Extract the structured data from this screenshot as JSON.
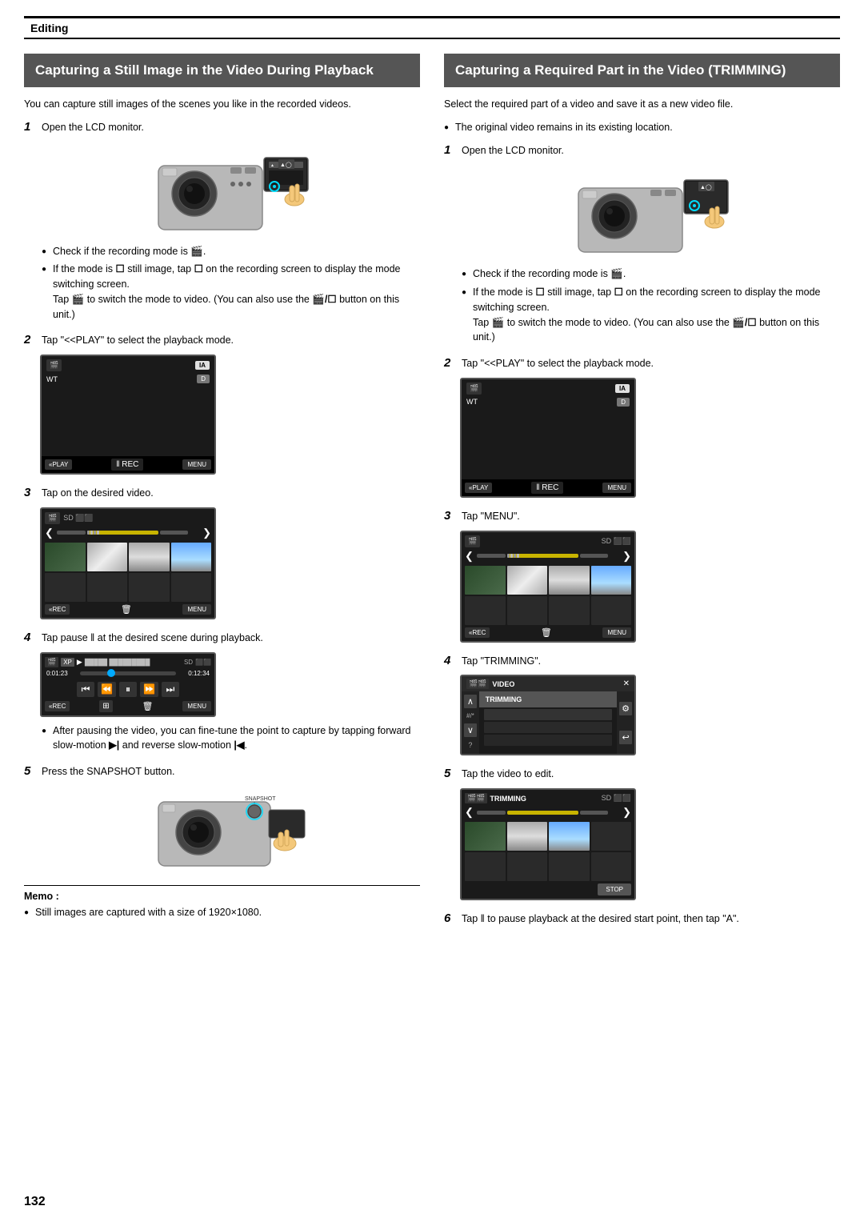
{
  "page": {
    "number": "132",
    "section": "Editing"
  },
  "left_section": {
    "title": "Capturing a Still Image in the Video During Playback",
    "intro": "You can capture still images of the scenes you like in the recorded videos.",
    "steps": [
      {
        "num": "1",
        "text": "Open the LCD monitor.",
        "has_camera_image": true,
        "bullets": [
          "Check if the recording mode is 🎬.",
          "If the mode is ☐ still image, tap ☐ on the recording screen to display the mode switching screen. Tap 🎬 to switch the mode to video. (You can also use the 🎬/☐ button on this unit.)"
        ]
      },
      {
        "num": "2",
        "text": "Tap \"<<PLAY\" to select the playback mode.",
        "has_play_screen": true
      },
      {
        "num": "3",
        "text": "Tap on the desired video.",
        "has_gallery_screen": true
      },
      {
        "num": "4",
        "text": "Tap pause ‖ at the desired scene during playback.",
        "has_playback_screen": true,
        "bullet": "After pausing the video, you can fine-tune the point to capture by tapping forward slow-motion ▶| and reverse slow-motion |◀."
      },
      {
        "num": "5",
        "text": "Press the SNAPSHOT button.",
        "has_snapshot_image": true
      }
    ],
    "memo": {
      "title": "Memo :",
      "bullets": [
        "Still images are captured with a size of 1920×1080."
      ]
    },
    "screen_labels": {
      "play_btn": "«PLAY",
      "rec_btn": "‖  REC",
      "menu_btn": "MENU",
      "rec_btn2": "«REC",
      "ia_badge": "IA",
      "wt_label": "WT",
      "d_badge": "D",
      "time_start": "0:01:23",
      "time_end": "0:12:34"
    }
  },
  "right_section": {
    "title": "Capturing a Required Part in the Video (TRIMMING)",
    "intro": "Select the required part of a video and save it as a new video file.",
    "bullets_intro": [
      "The original video remains in its existing location."
    ],
    "steps": [
      {
        "num": "1",
        "text": "Open the LCD monitor.",
        "has_camera_image": true,
        "bullets": [
          "Check if the recording mode is 🎬.",
          "If the mode is ☐ still image, tap ☐ on the recording screen to display the mode switching screen. Tap 🎬 to switch the mode to video. (You can also use the 🎬/☐ button on this unit.)"
        ]
      },
      {
        "num": "2",
        "text": "Tap \"<<PLAY\" to select the playback mode.",
        "has_play_screen": true
      },
      {
        "num": "3",
        "text": "Tap \"MENU\".",
        "has_gallery_screen": true
      },
      {
        "num": "4",
        "text": "Tap \"TRIMMING\".",
        "has_menu_screen": true
      },
      {
        "num": "5",
        "text": "Tap the video to edit.",
        "has_trimming_screen": true
      },
      {
        "num": "6",
        "text": "Tap ‖ to pause playback at the desired start point, then tap \"A\"."
      }
    ],
    "menu_items": {
      "title": "VIDEO",
      "selected": "TRIMMING",
      "items": [
        "████ ████ ██",
        "████ ████ ██",
        "████ ████ ██"
      ],
      "close_icon": "✕",
      "gear_icon": "⚙",
      "back_icon": "↩"
    }
  }
}
